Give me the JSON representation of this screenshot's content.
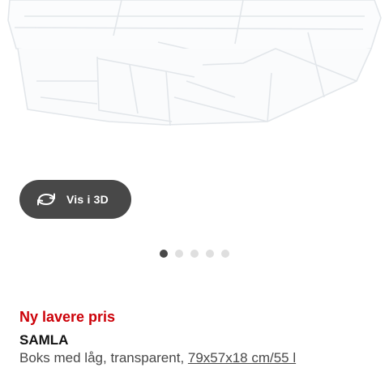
{
  "view_3d_button": {
    "label": "Vis i 3D",
    "icon": "rotate-3d-icon"
  },
  "carousel": {
    "total": 5,
    "active_index": 0
  },
  "product": {
    "badge": "Ny lavere pris",
    "name": "SAMLA",
    "description_prefix": "Boks med låg, transparent, ",
    "size_link": "79x57x18 cm/55 l"
  },
  "colors": {
    "price_badge": "#cc0008",
    "button_bg": "#484848",
    "dot_active": "#484848",
    "dot_inactive": "#dfdfdf"
  }
}
